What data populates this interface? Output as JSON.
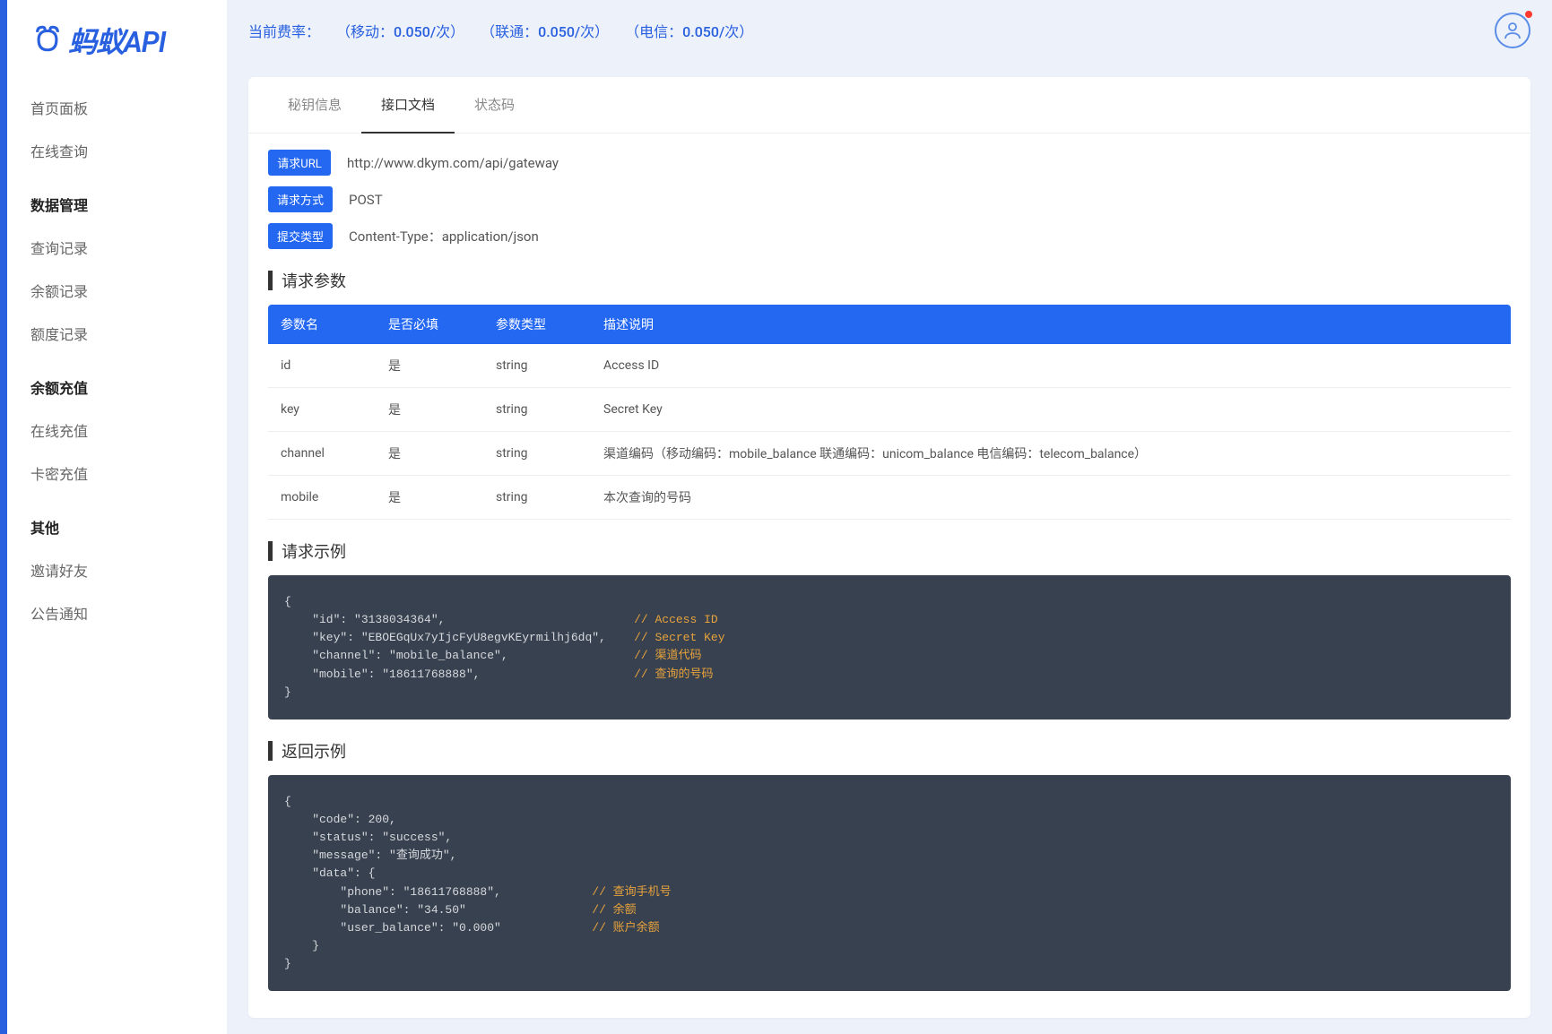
{
  "logo": {
    "text": "蚂蚁API"
  },
  "sidebar": {
    "items": [
      {
        "label": "首页面板",
        "header": false
      },
      {
        "label": "在线查询",
        "header": false
      },
      {
        "label": "数据管理",
        "header": true
      },
      {
        "label": "查询记录",
        "header": false
      },
      {
        "label": "余额记录",
        "header": false
      },
      {
        "label": "额度记录",
        "header": false
      },
      {
        "label": "余额充值",
        "header": true
      },
      {
        "label": "在线充值",
        "header": false
      },
      {
        "label": "卡密充值",
        "header": false
      },
      {
        "label": "其他",
        "header": true
      },
      {
        "label": "邀请好友",
        "header": false
      },
      {
        "label": "公告通知",
        "header": false
      }
    ]
  },
  "topbar": {
    "rate_prefix": "当前费率：",
    "rates": [
      "（移动：0.050/次）",
      "（联通：0.050/次）",
      "（电信：0.050/次）"
    ]
  },
  "tabs": [
    {
      "label": "秘钥信息",
      "active": false
    },
    {
      "label": "接口文档",
      "active": true
    },
    {
      "label": "状态码",
      "active": false
    }
  ],
  "info_rows": [
    {
      "badge": "请求URL",
      "value": "http://www.dkym.com/api/gateway"
    },
    {
      "badge": "请求方式",
      "value": "POST"
    },
    {
      "badge": "提交类型",
      "value": "Content-Type：application/json"
    }
  ],
  "sections": {
    "params_title": "请求参数",
    "req_example_title": "请求示例",
    "resp_example_title": "返回示例"
  },
  "params_header": [
    "参数名",
    "是否必填",
    "参数类型",
    "描述说明"
  ],
  "params": [
    {
      "name": "id",
      "required": "是",
      "type": "string",
      "desc": "Access ID"
    },
    {
      "name": "key",
      "required": "是",
      "type": "string",
      "desc": "Secret Key"
    },
    {
      "name": "channel",
      "required": "是",
      "type": "string",
      "desc": "渠道编码（移动编码：mobile_balance 联通编码：unicom_balance 电信编码：telecom_balance）"
    },
    {
      "name": "mobile",
      "required": "是",
      "type": "string",
      "desc": "本次查询的号码"
    }
  ],
  "req_example": {
    "lines": [
      {
        "text": "{"
      },
      {
        "text": "    \"id\": \"3138034364\",",
        "pad": 50,
        "cmt": "// Access ID"
      },
      {
        "text": "    \"key\": \"EBOEGqUx7yIjcFyU8egvKEyrmilhj6dq\",",
        "pad": 50,
        "cmt": "// Secret Key"
      },
      {
        "text": "    \"channel\": \"mobile_balance\",",
        "pad": 50,
        "cmt": "// 渠道代码"
      },
      {
        "text": "    \"mobile\": \"18611768888\",",
        "pad": 50,
        "cmt": "// 查询的号码"
      },
      {
        "text": "}"
      }
    ]
  },
  "resp_example": {
    "lines": [
      {
        "text": "{"
      },
      {
        "text": "    \"code\": 200,"
      },
      {
        "text": "    \"status\": \"success\","
      },
      {
        "text": "    \"message\": \"查询成功\","
      },
      {
        "text": "    \"data\": {"
      },
      {
        "text": "        \"phone\": \"18611768888\",",
        "pad": 44,
        "cmt": "// 查询手机号"
      },
      {
        "text": "        \"balance\": \"34.50\"",
        "pad": 44,
        "cmt": "// 余额"
      },
      {
        "text": "        \"user_balance\": \"0.000\"",
        "pad": 44,
        "cmt": "// 账户余额"
      },
      {
        "text": "    }"
      },
      {
        "text": "}"
      }
    ]
  }
}
